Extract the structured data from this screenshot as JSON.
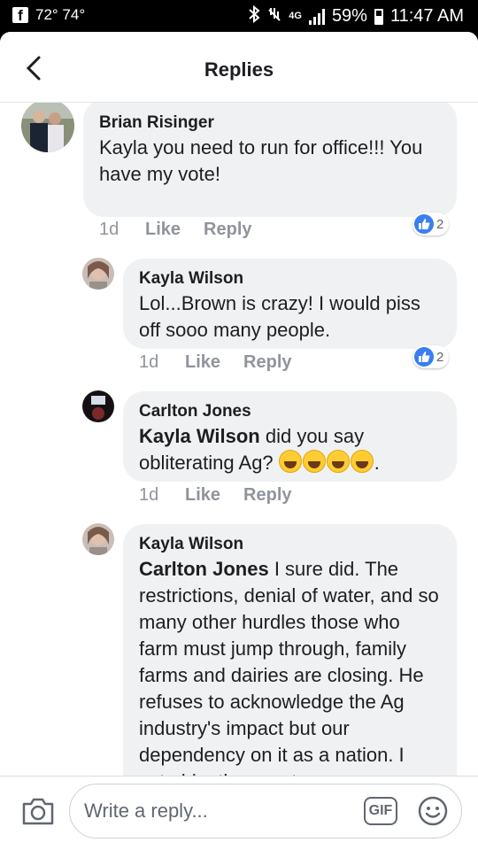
{
  "status_bar": {
    "temperature": "72° 74°",
    "network": "4G",
    "battery": "59%",
    "time": "11:47 AM"
  },
  "header": {
    "title": "Replies"
  },
  "comments": [
    {
      "author": "Brian Risinger",
      "text": "Kayla you need to run for office!!! You have my vote!",
      "time": "1d",
      "like_label": "Like",
      "reply_label": "Reply",
      "reaction_count": "2"
    },
    {
      "author": "Kayla Wilson",
      "text": "Lol...Brown is crazy! I would piss off sooo many people.",
      "time": "1d",
      "like_label": "Like",
      "reply_label": "Reply",
      "reaction_count": "2"
    },
    {
      "author": "Carlton Jones",
      "mention": "Kayla Wilson",
      "text": " did you say obliterating Ag?",
      "emoji_tail": ".",
      "time": "1d",
      "like_label": "Like",
      "reply_label": "Reply"
    },
    {
      "author": "Kayla Wilson",
      "mention": "Carlton Jones",
      "text": "  I sure did.  The restrictions,  denial of water, and so many other hurdles those who farm must jump through, family farms and dairies are closing. He refuses to acknowledge the Ag industry's impact but our dependency on it as a nation.  I vote him the worst governor"
    }
  ],
  "composer": {
    "placeholder": "Write a reply...",
    "gif_label": "GIF"
  },
  "colors": {
    "bubble": "#f0f1f3",
    "like_blue": "#3a7ff0",
    "meta_gray": "#90949c"
  }
}
